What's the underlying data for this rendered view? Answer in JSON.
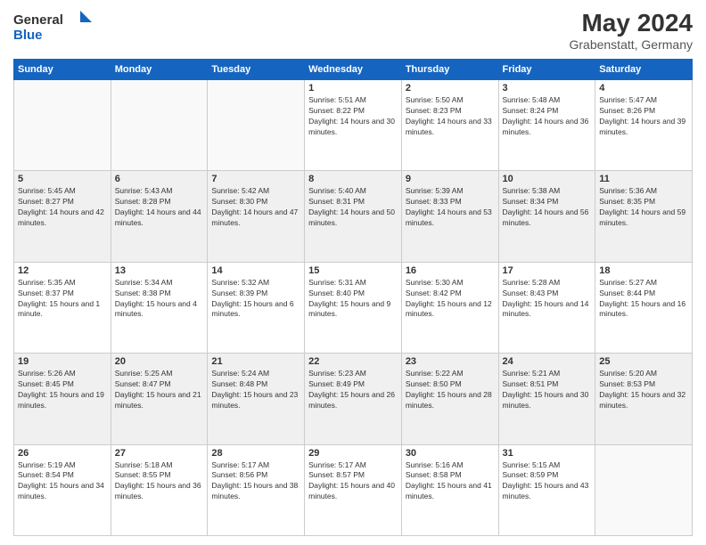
{
  "header": {
    "logo_general": "General",
    "logo_blue": "Blue",
    "month_year": "May 2024",
    "location": "Grabenstatt, Germany"
  },
  "days_of_week": [
    "Sunday",
    "Monday",
    "Tuesday",
    "Wednesday",
    "Thursday",
    "Friday",
    "Saturday"
  ],
  "weeks": [
    [
      {
        "day": "",
        "sunrise": "",
        "sunset": "",
        "daylight": "",
        "empty": true
      },
      {
        "day": "",
        "sunrise": "",
        "sunset": "",
        "daylight": "",
        "empty": true
      },
      {
        "day": "",
        "sunrise": "",
        "sunset": "",
        "daylight": "",
        "empty": true
      },
      {
        "day": "1",
        "sunrise": "Sunrise: 5:51 AM",
        "sunset": "Sunset: 8:22 PM",
        "daylight": "Daylight: 14 hours and 30 minutes.",
        "empty": false
      },
      {
        "day": "2",
        "sunrise": "Sunrise: 5:50 AM",
        "sunset": "Sunset: 8:23 PM",
        "daylight": "Daylight: 14 hours and 33 minutes.",
        "empty": false
      },
      {
        "day": "3",
        "sunrise": "Sunrise: 5:48 AM",
        "sunset": "Sunset: 8:24 PM",
        "daylight": "Daylight: 14 hours and 36 minutes.",
        "empty": false
      },
      {
        "day": "4",
        "sunrise": "Sunrise: 5:47 AM",
        "sunset": "Sunset: 8:26 PM",
        "daylight": "Daylight: 14 hours and 39 minutes.",
        "empty": false
      }
    ],
    [
      {
        "day": "5",
        "sunrise": "Sunrise: 5:45 AM",
        "sunset": "Sunset: 8:27 PM",
        "daylight": "Daylight: 14 hours and 42 minutes.",
        "empty": false
      },
      {
        "day": "6",
        "sunrise": "Sunrise: 5:43 AM",
        "sunset": "Sunset: 8:28 PM",
        "daylight": "Daylight: 14 hours and 44 minutes.",
        "empty": false
      },
      {
        "day": "7",
        "sunrise": "Sunrise: 5:42 AM",
        "sunset": "Sunset: 8:30 PM",
        "daylight": "Daylight: 14 hours and 47 minutes.",
        "empty": false
      },
      {
        "day": "8",
        "sunrise": "Sunrise: 5:40 AM",
        "sunset": "Sunset: 8:31 PM",
        "daylight": "Daylight: 14 hours and 50 minutes.",
        "empty": false
      },
      {
        "day": "9",
        "sunrise": "Sunrise: 5:39 AM",
        "sunset": "Sunset: 8:33 PM",
        "daylight": "Daylight: 14 hours and 53 minutes.",
        "empty": false
      },
      {
        "day": "10",
        "sunrise": "Sunrise: 5:38 AM",
        "sunset": "Sunset: 8:34 PM",
        "daylight": "Daylight: 14 hours and 56 minutes.",
        "empty": false
      },
      {
        "day": "11",
        "sunrise": "Sunrise: 5:36 AM",
        "sunset": "Sunset: 8:35 PM",
        "daylight": "Daylight: 14 hours and 59 minutes.",
        "empty": false
      }
    ],
    [
      {
        "day": "12",
        "sunrise": "Sunrise: 5:35 AM",
        "sunset": "Sunset: 8:37 PM",
        "daylight": "Daylight: 15 hours and 1 minute.",
        "empty": false
      },
      {
        "day": "13",
        "sunrise": "Sunrise: 5:34 AM",
        "sunset": "Sunset: 8:38 PM",
        "daylight": "Daylight: 15 hours and 4 minutes.",
        "empty": false
      },
      {
        "day": "14",
        "sunrise": "Sunrise: 5:32 AM",
        "sunset": "Sunset: 8:39 PM",
        "daylight": "Daylight: 15 hours and 6 minutes.",
        "empty": false
      },
      {
        "day": "15",
        "sunrise": "Sunrise: 5:31 AM",
        "sunset": "Sunset: 8:40 PM",
        "daylight": "Daylight: 15 hours and 9 minutes.",
        "empty": false
      },
      {
        "day": "16",
        "sunrise": "Sunrise: 5:30 AM",
        "sunset": "Sunset: 8:42 PM",
        "daylight": "Daylight: 15 hours and 12 minutes.",
        "empty": false
      },
      {
        "day": "17",
        "sunrise": "Sunrise: 5:28 AM",
        "sunset": "Sunset: 8:43 PM",
        "daylight": "Daylight: 15 hours and 14 minutes.",
        "empty": false
      },
      {
        "day": "18",
        "sunrise": "Sunrise: 5:27 AM",
        "sunset": "Sunset: 8:44 PM",
        "daylight": "Daylight: 15 hours and 16 minutes.",
        "empty": false
      }
    ],
    [
      {
        "day": "19",
        "sunrise": "Sunrise: 5:26 AM",
        "sunset": "Sunset: 8:45 PM",
        "daylight": "Daylight: 15 hours and 19 minutes.",
        "empty": false
      },
      {
        "day": "20",
        "sunrise": "Sunrise: 5:25 AM",
        "sunset": "Sunset: 8:47 PM",
        "daylight": "Daylight: 15 hours and 21 minutes.",
        "empty": false
      },
      {
        "day": "21",
        "sunrise": "Sunrise: 5:24 AM",
        "sunset": "Sunset: 8:48 PM",
        "daylight": "Daylight: 15 hours and 23 minutes.",
        "empty": false
      },
      {
        "day": "22",
        "sunrise": "Sunrise: 5:23 AM",
        "sunset": "Sunset: 8:49 PM",
        "daylight": "Daylight: 15 hours and 26 minutes.",
        "empty": false
      },
      {
        "day": "23",
        "sunrise": "Sunrise: 5:22 AM",
        "sunset": "Sunset: 8:50 PM",
        "daylight": "Daylight: 15 hours and 28 minutes.",
        "empty": false
      },
      {
        "day": "24",
        "sunrise": "Sunrise: 5:21 AM",
        "sunset": "Sunset: 8:51 PM",
        "daylight": "Daylight: 15 hours and 30 minutes.",
        "empty": false
      },
      {
        "day": "25",
        "sunrise": "Sunrise: 5:20 AM",
        "sunset": "Sunset: 8:53 PM",
        "daylight": "Daylight: 15 hours and 32 minutes.",
        "empty": false
      }
    ],
    [
      {
        "day": "26",
        "sunrise": "Sunrise: 5:19 AM",
        "sunset": "Sunset: 8:54 PM",
        "daylight": "Daylight: 15 hours and 34 minutes.",
        "empty": false
      },
      {
        "day": "27",
        "sunrise": "Sunrise: 5:18 AM",
        "sunset": "Sunset: 8:55 PM",
        "daylight": "Daylight: 15 hours and 36 minutes.",
        "empty": false
      },
      {
        "day": "28",
        "sunrise": "Sunrise: 5:17 AM",
        "sunset": "Sunset: 8:56 PM",
        "daylight": "Daylight: 15 hours and 38 minutes.",
        "empty": false
      },
      {
        "day": "29",
        "sunrise": "Sunrise: 5:17 AM",
        "sunset": "Sunset: 8:57 PM",
        "daylight": "Daylight: 15 hours and 40 minutes.",
        "empty": false
      },
      {
        "day": "30",
        "sunrise": "Sunrise: 5:16 AM",
        "sunset": "Sunset: 8:58 PM",
        "daylight": "Daylight: 15 hours and 41 minutes.",
        "empty": false
      },
      {
        "day": "31",
        "sunrise": "Sunrise: 5:15 AM",
        "sunset": "Sunset: 8:59 PM",
        "daylight": "Daylight: 15 hours and 43 minutes.",
        "empty": false
      },
      {
        "day": "",
        "sunrise": "",
        "sunset": "",
        "daylight": "",
        "empty": true
      }
    ]
  ]
}
